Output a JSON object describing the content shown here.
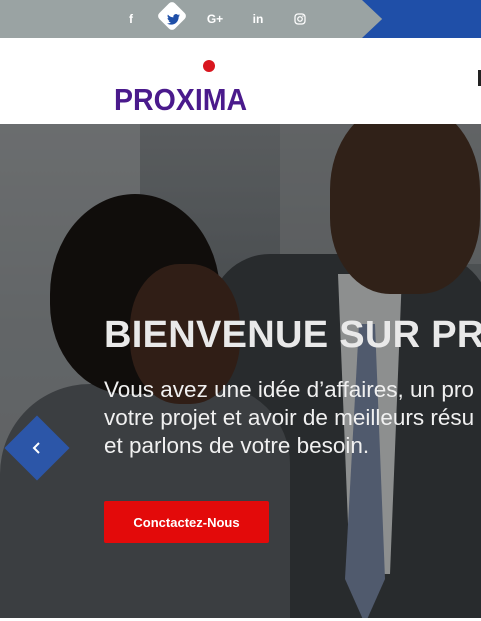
{
  "social": {
    "icons": [
      "facebook-icon",
      "twitter-icon",
      "google-plus-icon",
      "linkedin-icon",
      "instagram-icon"
    ],
    "facebook": "f",
    "google_plus": "G+",
    "linkedin": "in"
  },
  "logo": {
    "text": "PROXIMA",
    "brand_color": "#4a1a8c",
    "accent_color": "#d9161f"
  },
  "hero": {
    "title": "BIENVENUE SUR PRO",
    "text_lines": [
      "Vous avez une idée d’affaires, un pro",
      "votre projet et avoir de meilleurs résu",
      "et parlons de votre besoin."
    ],
    "cta_label": "Conctactez-Nous",
    "cta_color": "#e30a0a",
    "nav_prev_icon": "chevron-left-icon",
    "nav_color": "#2c56a8"
  }
}
